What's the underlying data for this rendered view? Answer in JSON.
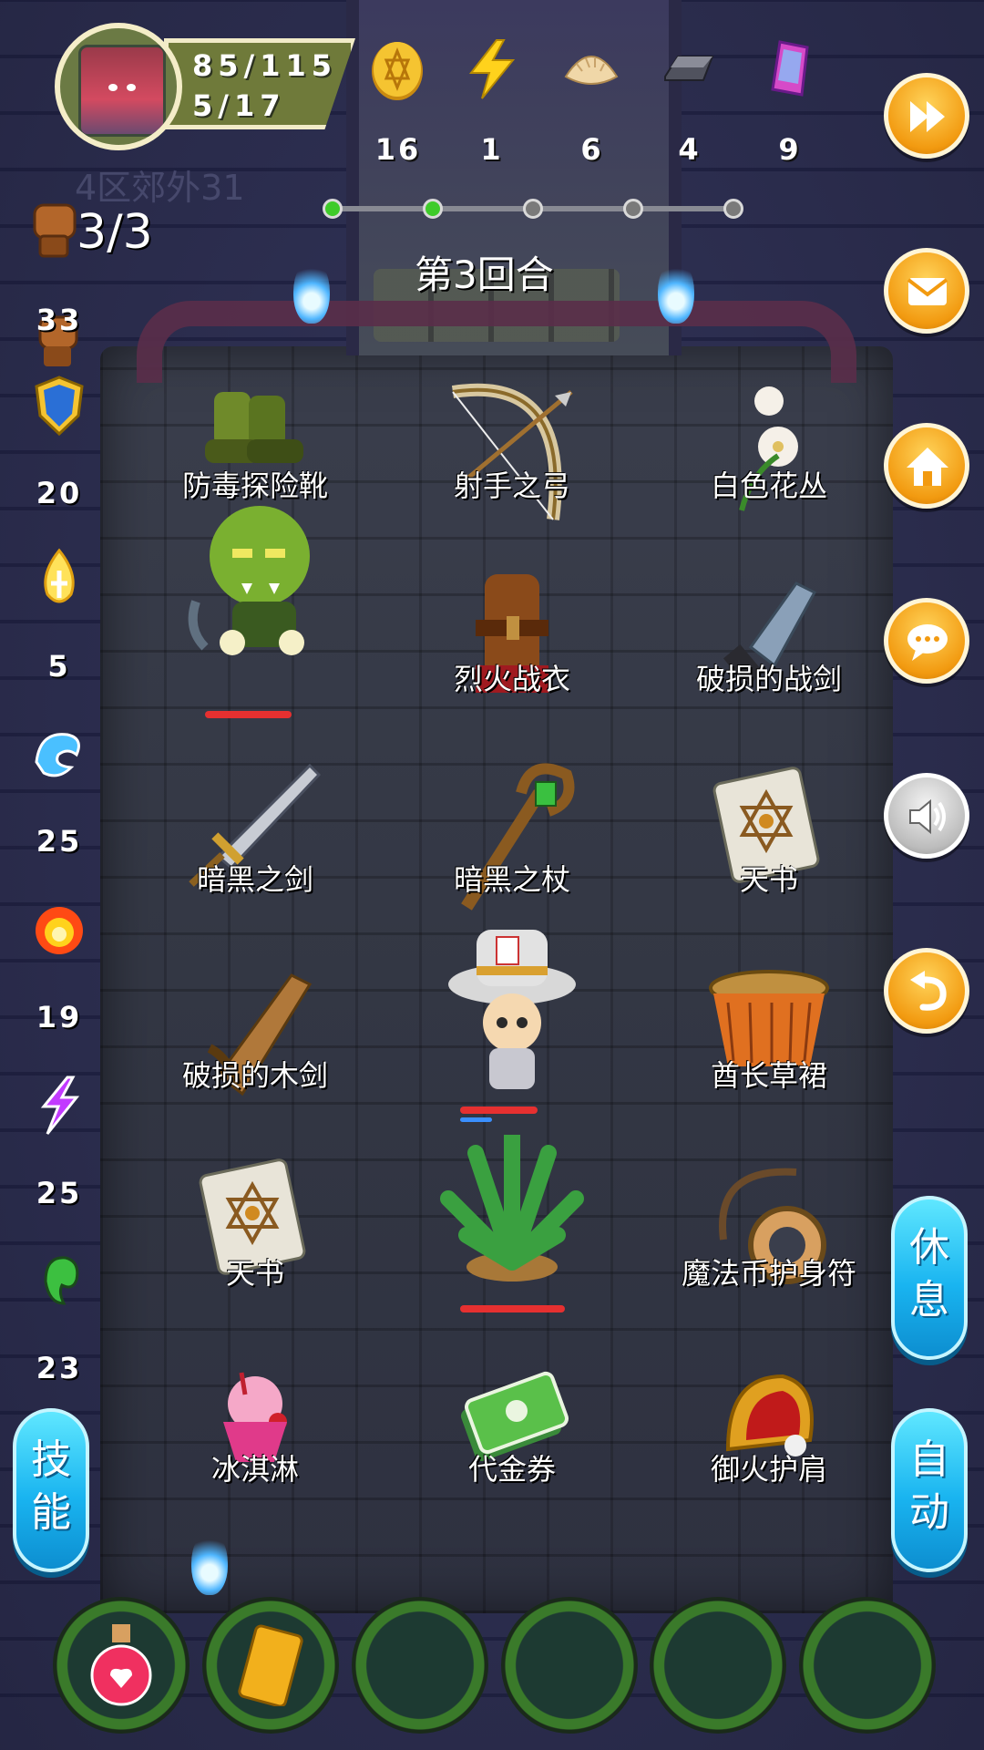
{
  "hud": {
    "hp": "85/115",
    "level": "5/17",
    "zone": "4区郊外31",
    "turns": "3/3",
    "round_label": "第3回合"
  },
  "resources": [
    {
      "name": "gold-coin",
      "value": "16"
    },
    {
      "name": "energy",
      "value": "1"
    },
    {
      "name": "dumpling",
      "value": "6"
    },
    {
      "name": "iron-ingot",
      "value": "4"
    },
    {
      "name": "gem",
      "value": "9"
    }
  ],
  "progress": {
    "total": 5,
    "completed": 2,
    "done_color": "#3ecb2a",
    "pending_color": "#7a7a7a"
  },
  "left_stats": [
    {
      "name": "attack",
      "value": "33"
    },
    {
      "name": "defense",
      "value": "20"
    },
    {
      "name": "holy",
      "value": "5"
    },
    {
      "name": "water",
      "value": "25"
    },
    {
      "name": "fire",
      "value": "19"
    },
    {
      "name": "thunder",
      "value": "25"
    },
    {
      "name": "poison",
      "value": "23"
    }
  ],
  "right_buttons": [
    "fast-forward",
    "mail",
    "home",
    "chat",
    "sound",
    "back"
  ],
  "pills": {
    "skills": [
      "技",
      "能"
    ],
    "rest": [
      "休",
      "息"
    ],
    "auto": [
      "自",
      "动"
    ]
  },
  "grid": [
    {
      "label": "防毒探险靴"
    },
    {
      "label": "射手之弓"
    },
    {
      "label": "白色花丛"
    },
    {
      "label": ""
    },
    {
      "label": "烈火战衣"
    },
    {
      "label": "破损的战剑"
    },
    {
      "label": "暗黑之剑"
    },
    {
      "label": "暗黑之杖"
    },
    {
      "label": "天书"
    },
    {
      "label": "破损的木剑"
    },
    {
      "label": ""
    },
    {
      "label": "酋长草裙"
    },
    {
      "label": "天书"
    },
    {
      "label": ""
    },
    {
      "label": "魔法币护身符"
    },
    {
      "label": "冰淇淋"
    },
    {
      "label": "代金券"
    },
    {
      "label": "御火护肩"
    }
  ],
  "bottom_slots": [
    "health-potion",
    "gold-bar",
    "",
    "",
    "",
    ""
  ],
  "colors": {
    "accent_orange": "#f29a10",
    "pill_blue": "#19b4f0",
    "hp_red": "#e63030"
  }
}
